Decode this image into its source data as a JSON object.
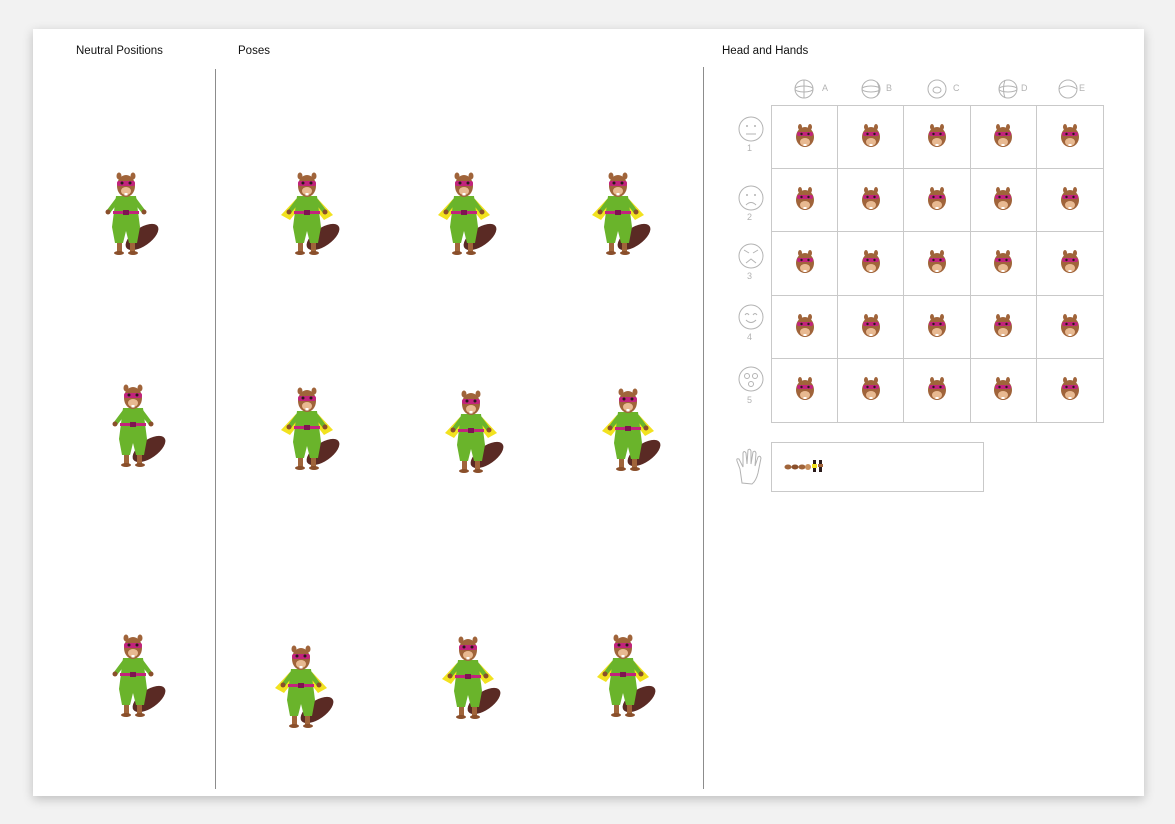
{
  "sections": {
    "neutral": "Neutral Positions",
    "poses": "Poses",
    "head_hands": "Head and Hands"
  },
  "head_grid": {
    "columns": [
      "A",
      "B",
      "C",
      "D",
      "E"
    ],
    "rows": [
      "1",
      "2",
      "3",
      "4",
      "5"
    ]
  },
  "colors": {
    "fur": "#a0643a",
    "fur_light": "#e8b991",
    "suit": "#6ab42b",
    "cape": "#f2e21f",
    "mask": "#c2237d",
    "tail": "#5a2a24",
    "grid_line": "#c9c9c9",
    "divider": "#8c8c8c"
  },
  "icons": {
    "column_icons": "head-turn-icon",
    "row_icons": "expression-face-icon",
    "hands": "hand-outline-icon"
  }
}
